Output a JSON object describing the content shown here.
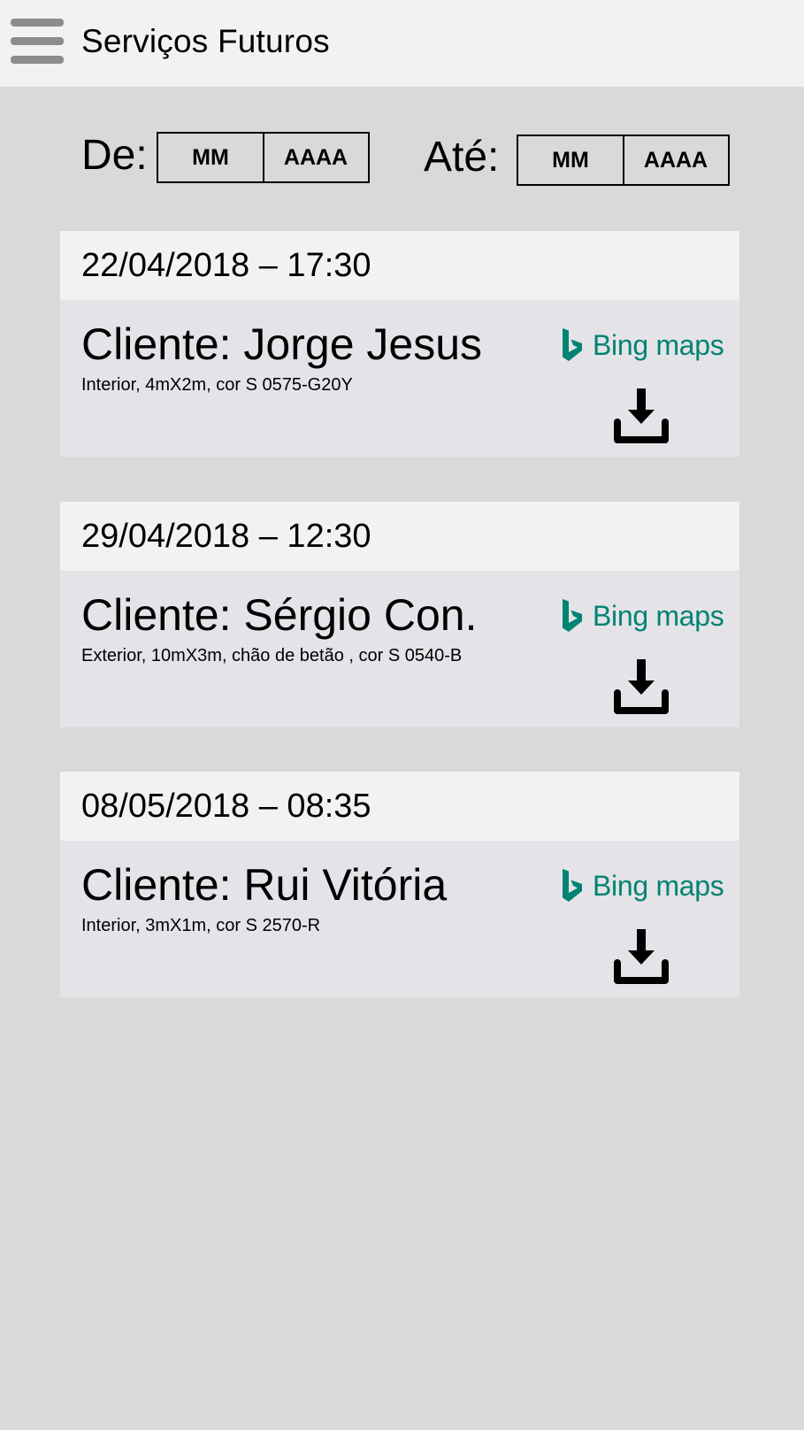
{
  "header": {
    "title": "Serviços Futuros",
    "menu_icon": "hamburger-menu-icon"
  },
  "filter": {
    "from_label": "De:",
    "to_label": "Até:",
    "from_month_placeholder": "MM",
    "from_year_placeholder": "AAAA",
    "to_month_placeholder": "MM",
    "to_year_placeholder": "AAAA"
  },
  "bing": {
    "bing_word": "Bing",
    "maps_word": "maps",
    "color": "#008373"
  },
  "services": [
    {
      "datetime": "22/04/2018 – 17:30",
      "client": "Cliente: Jorge Jesus",
      "description": "Interior, 4mX2m, cor S 0575-G20Y"
    },
    {
      "datetime": "29/04/2018 – 12:30",
      "client": "Cliente: Sérgio Con.",
      "description": "Exterior, 10mX3m, chão de betão , cor S 0540-B"
    },
    {
      "datetime": "08/05/2018 – 08:35",
      "client": "Cliente: Rui Vitória",
      "description": "Interior, 3mX1m, cor S 2570-R"
    }
  ],
  "colors": {
    "header_bg": "#f2f2f2",
    "page_bg": "#d9d9d9",
    "card_body_bg": "#e4e3e8",
    "menu_icon": "#8c8c8c"
  }
}
